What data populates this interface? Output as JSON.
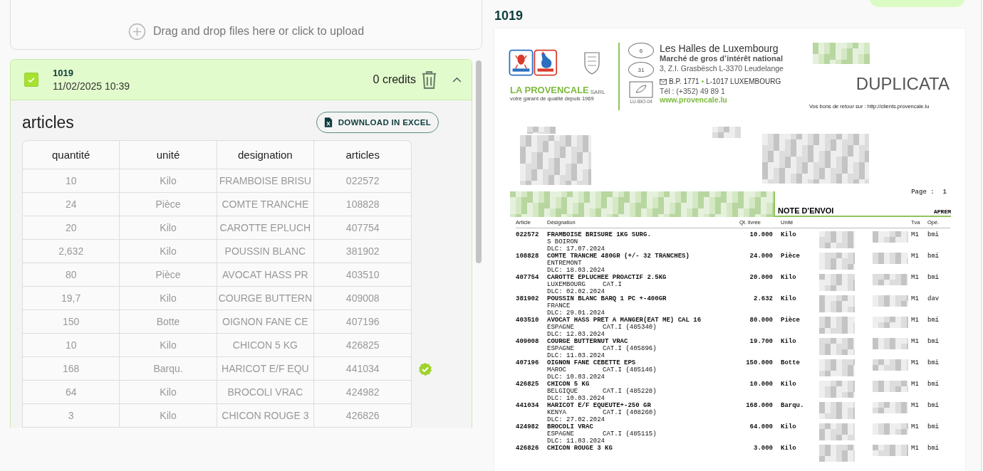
{
  "upload": {
    "text": "Drag and drop files here or click to upload"
  },
  "file": {
    "checked": true,
    "name": "1019",
    "date": "11/02/2025 10:39",
    "credits": "0 credits",
    "expanded": true,
    "section_title": "articles",
    "download_label": "DOWNLOAD IN EXCEL",
    "columns": [
      "quantité",
      "unité",
      "designation",
      "articles"
    ],
    "rows": [
      {
        "cells": [
          "10",
          "Kilo",
          "FRAMBOISE BRISU",
          "022572"
        ],
        "verified": false
      },
      {
        "cells": [
          "24",
          "Pièce",
          "COMTE TRANCHE",
          "108828"
        ],
        "verified": false
      },
      {
        "cells": [
          "20",
          "Kilo",
          "CAROTTE EPLUCH",
          "407754"
        ],
        "verified": false
      },
      {
        "cells": [
          "2,632",
          "Kilo",
          "POUSSIN BLANC",
          "381902"
        ],
        "verified": false
      },
      {
        "cells": [
          "80",
          "Pièce",
          "AVOCAT HASS PR",
          "403510"
        ],
        "verified": false
      },
      {
        "cells": [
          "19,7",
          "Kilo",
          "COURGE BUTTERN",
          "409008"
        ],
        "verified": false
      },
      {
        "cells": [
          "150",
          "Botte",
          "OIGNON FANE CE",
          "407196"
        ],
        "verified": false
      },
      {
        "cells": [
          "10",
          "Kilo",
          "CHICON 5 KG",
          "426825"
        ],
        "verified": false
      },
      {
        "cells": [
          "168",
          "Barqu.",
          "HARICOT E/F EQU",
          "441034"
        ],
        "verified": true
      },
      {
        "cells": [
          "64",
          "Kilo",
          "BROCOLI VRAC",
          "424982"
        ],
        "verified": false
      },
      {
        "cells": [
          "3",
          "Kilo",
          "CHICON ROUGE 3",
          "426826"
        ],
        "verified": false
      }
    ]
  },
  "preview": {
    "title": "1019",
    "document": {
      "header": {
        "brand": "LA PROVENCALE",
        "brand_suffix": "SARL",
        "tagline": "votre garant de qualité depuis 1969",
        "stamps": [
          "6",
          "31"
        ],
        "bio_code": "LU-BIO-04",
        "company": "Les Halles de Luxembourg",
        "subtitle": "Marché de gros d’intérêt national",
        "address": "3, Z.I. Grasbësch L-3370 Leudelange",
        "po_box": "B.P. 1771",
        "separator": "•",
        "city": "L-1017 LUXEMBOURG",
        "phone": "Tél : (+352) 49 89 1",
        "website": "www.provencale.lu"
      },
      "doc_type": "DUPLICATA",
      "returns_note": "Vos bons de retour sur : http://clients.provencale.lu",
      "page_label": "Page :",
      "page_number": "1",
      "note_title": "NOTE D'ENVOI",
      "shift": "APREM",
      "columns": [
        "Article",
        "Désignation",
        "Qt. livrée",
        "Unité",
        "Tva",
        "Opé."
      ],
      "items": [
        {
          "code": "022572",
          "designation": "FRAMBOISE BRISURE 1KG SURG.",
          "origin": "S BOIRON",
          "dlc": "DLC: 17.07.2024",
          "qty": "10.000",
          "unit": "Kilo",
          "tva": "M1",
          "ope": "bmi"
        },
        {
          "code": "108828",
          "designation": "COMTE TRANCHE 480GR (+/- 32 TRANCHES)",
          "origin": "ENTREMONT",
          "dlc": "DLC: 18.03.2024",
          "qty": "24.000",
          "unit": "Pièce",
          "tva": "M1",
          "ope": "bmi"
        },
        {
          "code": "407754",
          "designation": "CAROTTE EPLUCHEE PROACTIF 2.5KG",
          "origin": "LUXEMBOURG",
          "grade": "CAT.I",
          "dlc": "DLC: 02.02.2024",
          "qty": "20.000",
          "unit": "Kilo",
          "tva": "M1",
          "ope": "bmi"
        },
        {
          "code": "381902",
          "designation": "POUSSIN BLANC BARQ 1 PC +-400GR",
          "origin": "FRANCE",
          "dlc": "DLC: 29.01.2024",
          "qty": "2.632",
          "unit": "Kilo",
          "tva": "M1",
          "ope": "dav"
        },
        {
          "code": "403510",
          "designation": "AVOCAT HASS PRET A MANGER(EAT ME) CAL 16",
          "origin": "ESPAGNE",
          "grade": "CAT.I (485340)",
          "dlc": "DLC: 12.03.2024",
          "qty": "80.000",
          "unit": "Pièce",
          "tva": "M1",
          "ope": "bmi"
        },
        {
          "code": "409008",
          "designation": "COURGE BUTTERNUT VRAC",
          "origin": "ESPAGNE",
          "grade": "CAT.I (405896)",
          "dlc": "DLC: 11.03.2024",
          "qty": "19.700",
          "unit": "Kilo",
          "tva": "M1",
          "ope": "bmi"
        },
        {
          "code": "407196",
          "designation": "OIGNON FANE CEBETTE EPS",
          "origin": "MAROC",
          "grade": "CAT.I (485146)",
          "dlc": "DLC: 10.03.2024",
          "qty": "150.000",
          "unit": "Botte",
          "tva": "M1",
          "ope": "bmi"
        },
        {
          "code": "426825",
          "designation": "CHICON 5 KG",
          "origin": "BELGIQUE",
          "grade": "CAT.I (485228)",
          "dlc": "DLC: 10.03.2024",
          "qty": "10.000",
          "unit": "Kilo",
          "tva": "M1",
          "ope": "bmi"
        },
        {
          "code": "441034",
          "designation": "HARICOT E/F EQUEUTE+-250 GR",
          "origin": "KENYA",
          "grade": "CAT.I (408260)",
          "dlc": "DLC: 27.02.2024",
          "qty": "168.000",
          "unit": "Barqu.",
          "tva": "M1",
          "ope": "bmi"
        },
        {
          "code": "424982",
          "designation": "BROCOLI VRAC",
          "origin": "ESPAGNE",
          "grade": "CAT.I (485115)",
          "dlc": "DLC: 11.03.2024",
          "qty": "64.000",
          "unit": "Kilo",
          "tva": "M1",
          "ope": "bmi"
        },
        {
          "code": "426826",
          "designation": "CHICON ROUGE 3 KG",
          "qty": "3.000",
          "unit": "Kilo",
          "tva": "M1",
          "ope": "bmi"
        }
      ]
    }
  }
}
